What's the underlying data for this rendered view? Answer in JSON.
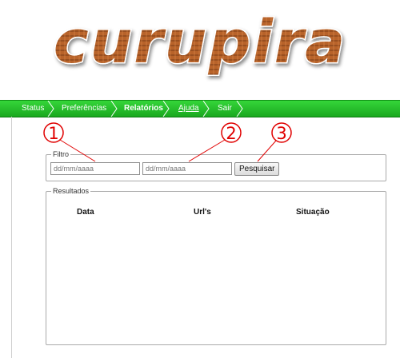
{
  "logo": {
    "text": "curupira"
  },
  "nav": {
    "items": [
      {
        "label": "Status"
      },
      {
        "label": "Preferências"
      },
      {
        "label": "Relatórios"
      },
      {
        "label": "Ajuda"
      },
      {
        "label": "Sair"
      }
    ]
  },
  "filter": {
    "legend": "Filtro",
    "start_date_placeholder": "dd/mm/aaaa",
    "end_date_placeholder": "dd/mm/aaaa",
    "search_label": "Pesquisar"
  },
  "results": {
    "legend": "Resultados",
    "columns": [
      "Data",
      "Url's",
      "Situação"
    ]
  },
  "callouts": [
    "1",
    "2",
    "3"
  ],
  "colors": {
    "nav_green": "#22b527",
    "callout_red": "#e00000",
    "logo_brown": "#a0521f"
  }
}
